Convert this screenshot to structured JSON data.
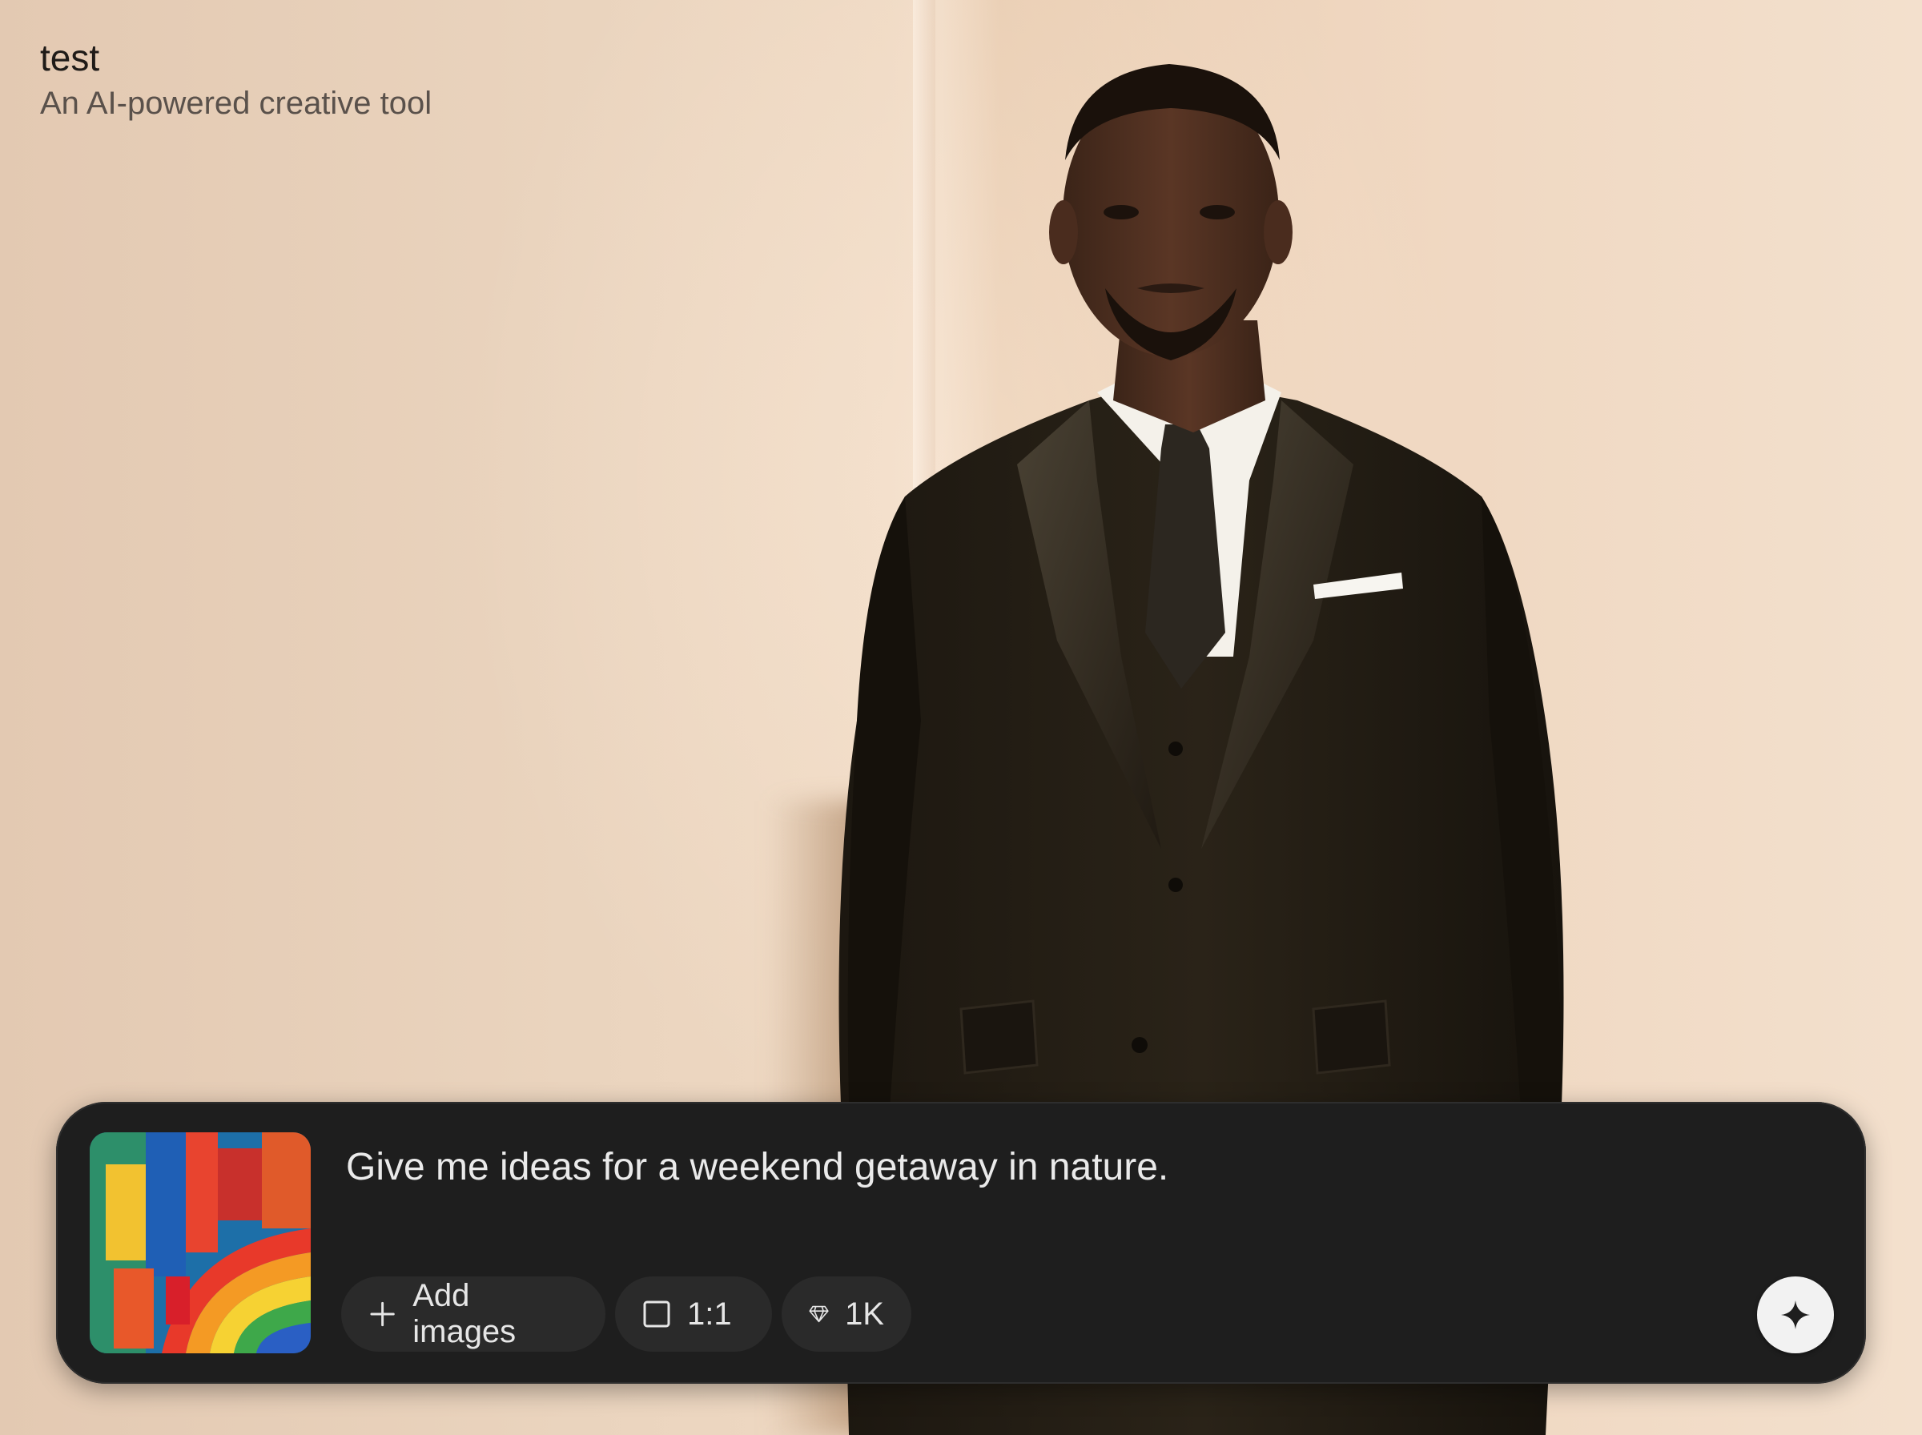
{
  "app": {
    "title": "test",
    "subtitle": "An AI-powered creative tool"
  },
  "prompt": {
    "text": "Give me ideas for a weekend getaway in nature."
  },
  "controls": {
    "add_images_label": "Add images",
    "aspect_ratio_label": "1:1",
    "resolution_label": "1K"
  },
  "icons": {
    "add": "plus-icon",
    "aspect": "square-icon",
    "resolution": "diamond-icon",
    "generate": "sparkle-icon"
  },
  "colors": {
    "panel_bg": "#1e1e1e",
    "pill_bg": "#2a2a2a",
    "generate_bg": "#f2f2f2",
    "wall": "#efd9c3"
  }
}
